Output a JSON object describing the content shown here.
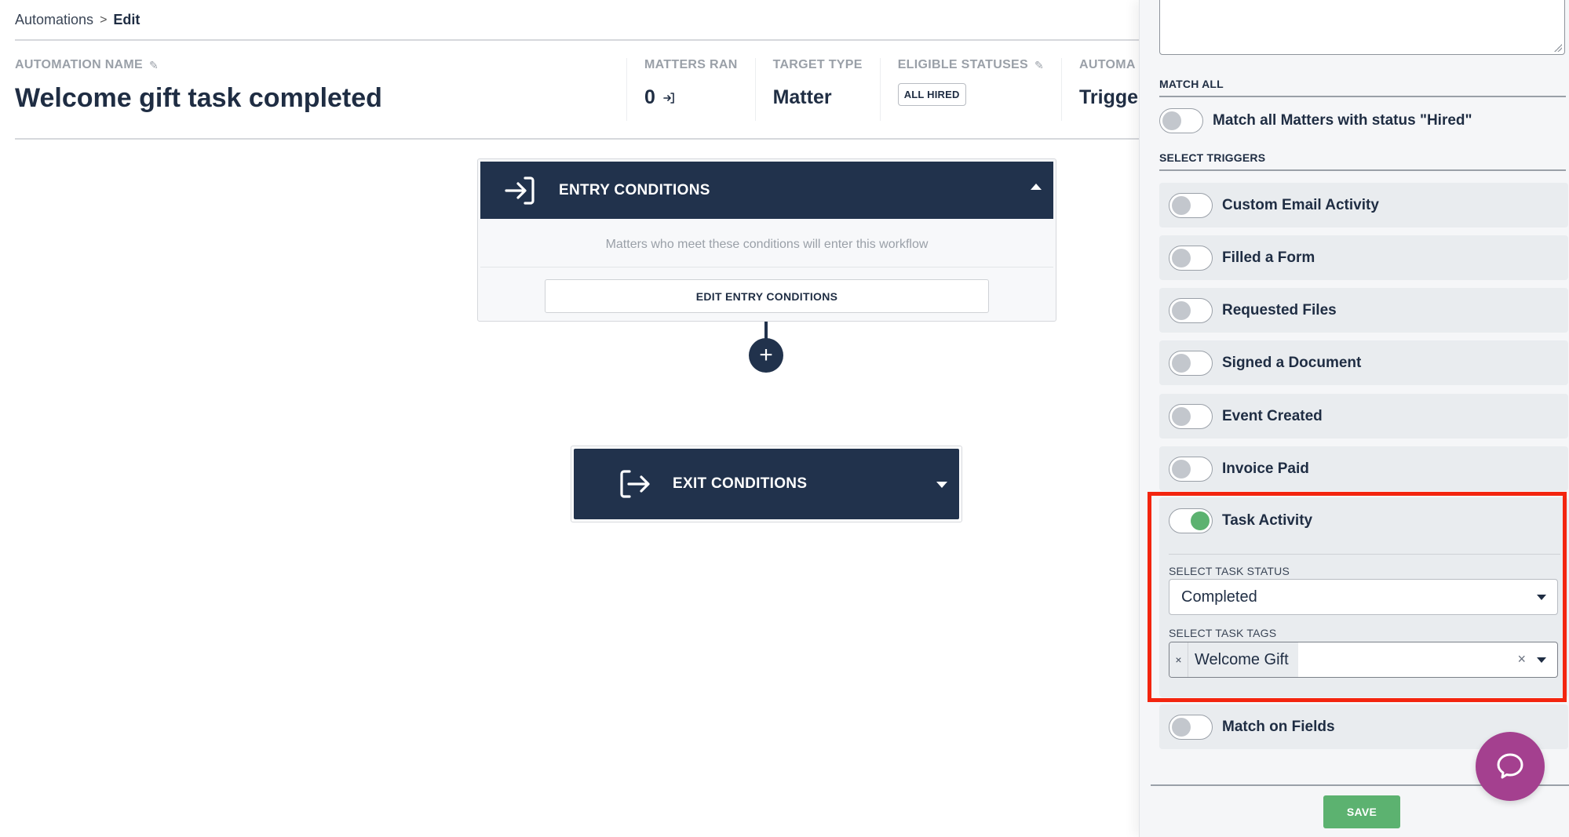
{
  "breadcrumb": {
    "parent": "Automations",
    "separator": ">",
    "current": "Edit"
  },
  "header": {
    "name_label": "AUTOMATION NAME",
    "title": "Welcome gift task completed",
    "stats": [
      {
        "label": "MATTERS RAN",
        "value": "0"
      },
      {
        "label": "TARGET TYPE",
        "value": "Matter"
      },
      {
        "label": "ELIGIBLE STATUSES",
        "badge": "ALL HIRED"
      },
      {
        "label": "AUTOMA",
        "value": "Trigge"
      }
    ]
  },
  "flow": {
    "entry": {
      "title": "ENTRY CONDITIONS",
      "description": "Matters who meet these conditions will enter this workflow",
      "edit_button": "EDIT ENTRY CONDITIONS",
      "expanded": true
    },
    "add_step_icon": "+",
    "exit": {
      "title": "EXIT CONDITIONS",
      "expanded": false
    }
  },
  "panel": {
    "description_value": "",
    "match_all": {
      "section_label": "MATCH ALL",
      "toggle_label": "Match all Matters with status \"Hired\"",
      "enabled": false
    },
    "triggers_label": "SELECT TRIGGERS",
    "triggers": [
      {
        "label": "Custom Email Activity",
        "enabled": false
      },
      {
        "label": "Filled a Form",
        "enabled": false
      },
      {
        "label": "Requested Files",
        "enabled": false
      },
      {
        "label": "Signed a Document",
        "enabled": false
      },
      {
        "label": "Event Created",
        "enabled": false
      },
      {
        "label": "Invoice Paid",
        "enabled": false
      }
    ],
    "task_activity": {
      "label": "Task Activity",
      "enabled": true,
      "status_label": "SELECT TASK STATUS",
      "status_value": "Completed",
      "tags_label": "SELECT TASK TAGS",
      "tags": [
        "Welcome Gift"
      ],
      "clear_icon": "×",
      "remove_tag_icon": "×"
    },
    "match_on_fields": {
      "label": "Match on Fields",
      "enabled": false
    },
    "save_label": "SAVE"
  },
  "colors": {
    "navy": "#21324c",
    "toggle_on": "#5cb270",
    "save": "#5cb270",
    "highlight": "#f3250f",
    "chat": "#a4408f"
  }
}
